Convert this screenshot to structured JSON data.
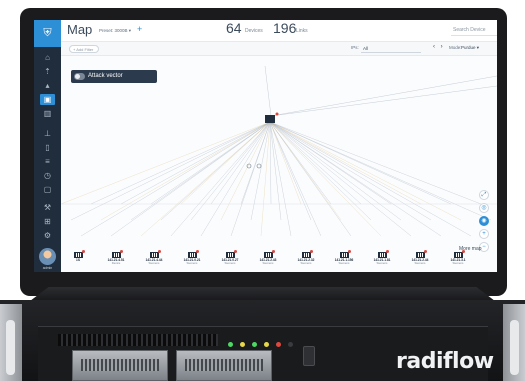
{
  "app": {
    "title": "Map",
    "preset_label": "Preset: 3000B ▾",
    "add_preset": "+",
    "devices_count": "64",
    "devices_label": "Devices",
    "links_count": "196",
    "links_label": "Links",
    "search_placeholder": "Search Device"
  },
  "filterbar": {
    "add_filter": "+ Add Filter",
    "ips_label": "IPs:",
    "ips_value": "All",
    "mode_label": "Mode:",
    "mode_value": "Purdue ▾"
  },
  "canvas": {
    "attack_vector_label": "Attack vector",
    "more_map_label": "More map"
  },
  "sidebar": {
    "user_label": "admin"
  },
  "devices": [
    {
      "ip": "1S",
      "name": ""
    },
    {
      "ip": "141.21.4.51",
      "name": "Device"
    },
    {
      "ip": "141.21.4.44",
      "name": "Siemens"
    },
    {
      "ip": "141.21.0.21",
      "name": "Siemens"
    },
    {
      "ip": "141.21.0.27",
      "name": "Siemens"
    },
    {
      "ip": "141.21.2.43",
      "name": "Siemens"
    },
    {
      "ip": "141.21.2.32",
      "name": "Siemens"
    },
    {
      "ip": "141.21.1.156",
      "name": "Siemens"
    },
    {
      "ip": "141.21.1.81",
      "name": "Siemens"
    },
    {
      "ip": "141.21.2.44",
      "name": "Siemens"
    },
    {
      "ip": "141.21.3.1",
      "name": "Siemens"
    }
  ],
  "appliance": {
    "brand": "radiflow"
  },
  "colors": {
    "sidebar": "#1f2d3d",
    "accent": "#2d8fd6",
    "alert": "#e0483e"
  }
}
